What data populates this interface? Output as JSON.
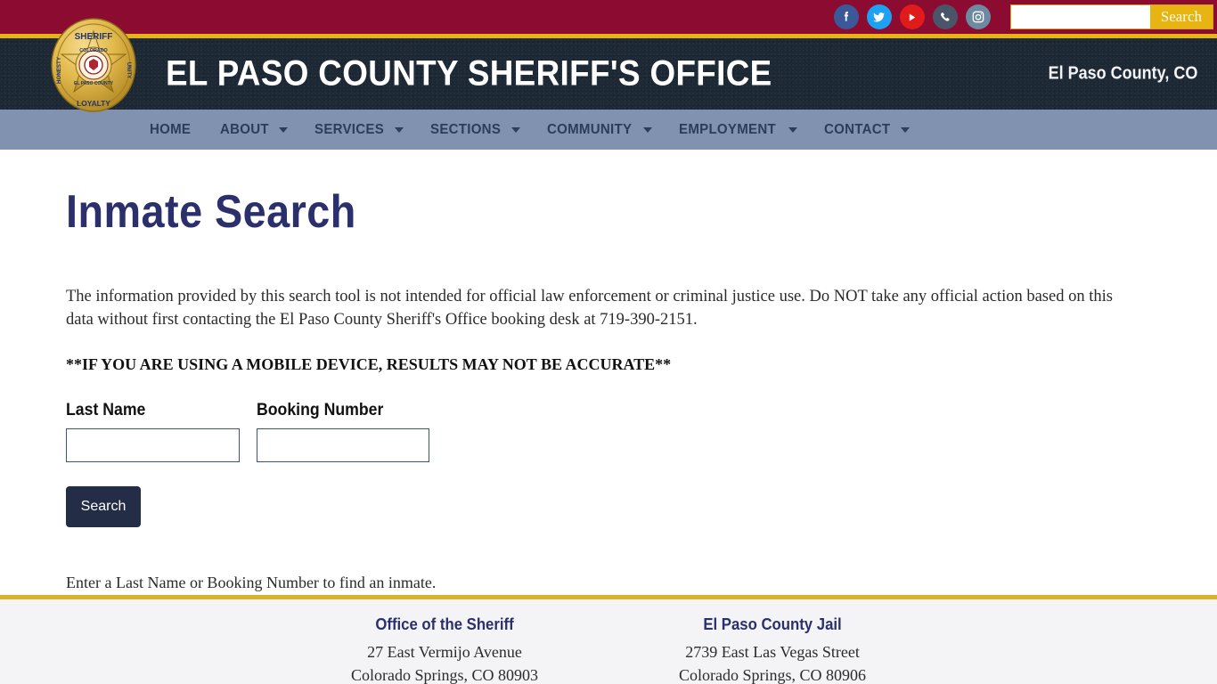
{
  "topbar": {
    "social": [
      {
        "name": "facebook-icon",
        "label": "Facebook",
        "color": "#3B5998"
      },
      {
        "name": "twitter-icon",
        "label": "Twitter",
        "color": "#1DA1F2"
      },
      {
        "name": "youtube-icon",
        "label": "YouTube",
        "color": "#E01B1B"
      },
      {
        "name": "phone-icon",
        "label": "Phone",
        "color": "#4A5568"
      },
      {
        "name": "instagram-icon",
        "label": "Instagram",
        "color": "#6E8AA3"
      }
    ],
    "search_value": "",
    "search_placeholder": "",
    "search_button": "Search"
  },
  "masthead": {
    "title": "EL PASO COUNTY SHERIFF'S OFFICE",
    "county": "El Paso County, CO",
    "badge": {
      "top_text": "SHERIFF",
      "left_text": "HONESTY",
      "right_text": "UNITY",
      "bottom_text": "LOYALTY",
      "inner_top": "COLORADO",
      "inner_bottom": "EL PASO COUNTY"
    }
  },
  "nav": {
    "items": [
      {
        "label": "HOME",
        "has_caret": false
      },
      {
        "label": "ABOUT",
        "has_caret": true
      },
      {
        "label": "SERVICES",
        "has_caret": true
      },
      {
        "label": "SECTIONS",
        "has_caret": true
      },
      {
        "label": "COMMUNITY",
        "has_caret": true
      },
      {
        "label": "EMPLOYMENT",
        "has_caret": true
      },
      {
        "label": "CONTACT",
        "has_caret": true
      }
    ]
  },
  "main": {
    "page_title": "Inmate Search",
    "disclaimer": "The information provided by this search tool is not intended for official law enforcement or criminal justice use. Do NOT take any official action based on this data without first contacting the El Paso County Sheriff's Office booking desk at 719-390-2151.",
    "mobile_warning": "**IF YOU ARE USING A MOBILE DEVICE, RESULTS MAY NOT BE ACCURATE**",
    "form": {
      "last_name_label": "Last Name",
      "last_name_value": "",
      "last_name_placeholder": "",
      "booking_number_label": "Booking Number",
      "booking_number_value": "",
      "booking_number_placeholder": "",
      "submit_label": "Search"
    },
    "hint": "Enter a Last Name or Booking Number to find an inmate."
  },
  "footer": {
    "columns": [
      {
        "heading": "Office of the Sheriff",
        "line1": "27 East Vermijo Avenue",
        "line2": "Colorado Springs, CO 80903"
      },
      {
        "heading": "El Paso County Jail",
        "line1": "2739 East Las Vegas Street",
        "line2": "Colorado Springs, CO 80906"
      }
    ]
  },
  "colors": {
    "maroon": "#8C0B30",
    "gold": "#E8B412",
    "dark_navy": "#1D2835",
    "nav_blue": "#8092B0",
    "title_navy": "#2B2F6B",
    "button_navy": "#232D46",
    "footer_bg": "#F4F4F6"
  }
}
